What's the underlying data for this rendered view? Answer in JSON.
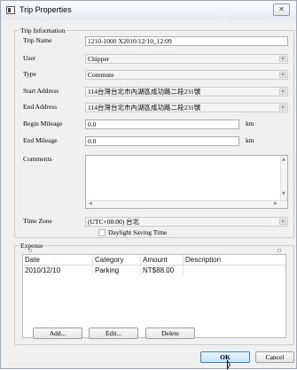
{
  "window": {
    "title": "Trip Properties",
    "close_glyph": "✕"
  },
  "trip_info": {
    "legend": "Trip Information",
    "trip_name": {
      "label": "Trip Name",
      "value": "1210-1000 X2010/12/10_12:09"
    },
    "user": {
      "label": "User",
      "value": "Chipper"
    },
    "type": {
      "label": "Type",
      "value": "Commute"
    },
    "start_address": {
      "label": "Start Address",
      "value": "114台灣台北市內湖區成功路二段231號"
    },
    "end_address": {
      "label": "End Address",
      "value": "114台灣台北市內湖區成功路二段231號"
    },
    "begin_mileage": {
      "label": "Begin Mileage",
      "value": "0.0",
      "unit": "km"
    },
    "end_mileage": {
      "label": "End Mileage",
      "value": "0.0",
      "unit": "km"
    },
    "comments": {
      "label": "Comments",
      "value": ""
    },
    "time_zone": {
      "label": "Time Zone",
      "value": "(UTC+08:00) 台北"
    },
    "dst": {
      "label": "Daylight Saving Time",
      "checked": false
    }
  },
  "expense": {
    "legend": "Expense",
    "columns": [
      "Date",
      "Category",
      "Amount",
      "Description"
    ],
    "rows": [
      {
        "date": "2010/12/10",
        "category": "Parking",
        "amount": "NT$88.00",
        "description": ""
      }
    ],
    "buttons": {
      "add": "Add...",
      "edit": "Edit...",
      "delete": "Delete"
    }
  },
  "footer": {
    "ok": "OK",
    "cancel": "Cancel"
  },
  "icons": {
    "window": "app-window-icon",
    "dropdown": "chevron-down-icon",
    "scroll_up": "scroll-up-icon",
    "scroll_down": "scroll-down-icon",
    "scroll_left": "scroll-left-icon",
    "scroll_right": "scroll-right-icon"
  }
}
